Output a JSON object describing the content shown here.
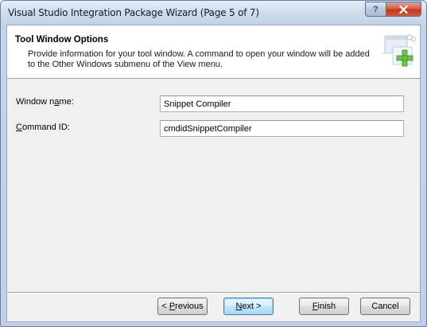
{
  "window": {
    "title": "Visual Studio Integration Package Wizard (Page 5 of 7)",
    "help_glyph": "?",
    "close_glyph": "x"
  },
  "header": {
    "title": "Tool Window Options",
    "description": "Provide information for your tool window. A command to open your window will be added to the Other Windows submenu of the View menu.",
    "icon": "wizard-add-icon"
  },
  "form": {
    "window_name": {
      "label_pre": "Window n",
      "label_mnemonic": "a",
      "label_post": "me:",
      "value": "Snippet Compiler"
    },
    "command_id": {
      "label_pre": "",
      "label_mnemonic": "C",
      "label_post": "ommand ID:",
      "value": "cmdidSnippetCompiler"
    }
  },
  "buttons": {
    "previous": {
      "pre": "< ",
      "mnemonic": "P",
      "post": "revious"
    },
    "next": {
      "pre": "",
      "mnemonic": "N",
      "post": "ext >"
    },
    "finish": {
      "pre": "",
      "mnemonic": "F",
      "post": "inish"
    },
    "cancel": {
      "pre": "",
      "mnemonic": "",
      "post": "Cancel"
    }
  },
  "colors": {
    "accent": "#3c7fb1",
    "close": "#c2361b",
    "header_bg": "#ffffff",
    "client_bg": "#f0f0f0"
  }
}
